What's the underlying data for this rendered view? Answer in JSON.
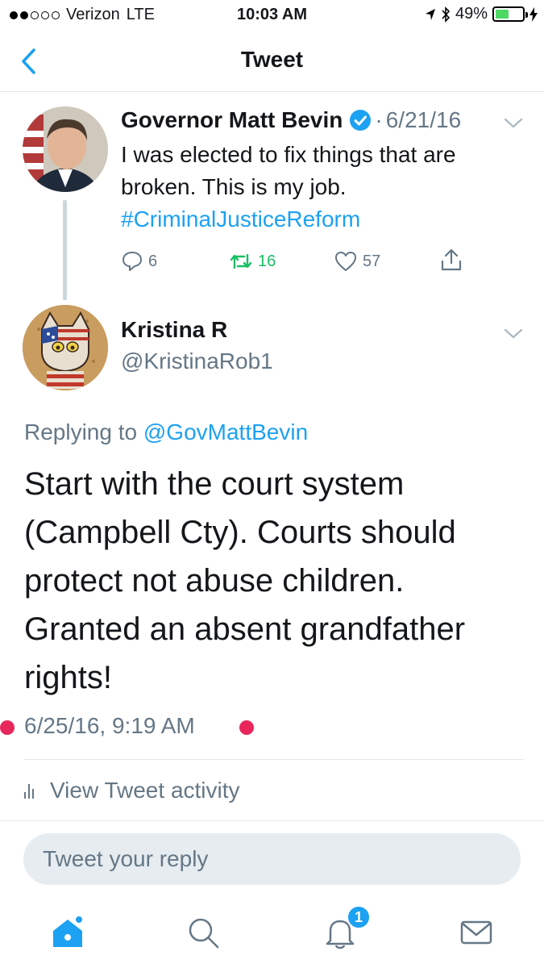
{
  "status_bar": {
    "carrier": "Verizon",
    "network": "LTE",
    "time": "10:03 AM",
    "battery": "49%",
    "battery_level": 0.49,
    "signal_bars": 2
  },
  "nav": {
    "title": "Tweet",
    "back_icon": "chevron-left-icon"
  },
  "parent_tweet": {
    "author": "Governor Matt Bevin",
    "separator": "·",
    "date": "6/21/16",
    "text": "I was elected to fix things that are broken. This is my job.",
    "hashtag": "#CriminalJusticeReform",
    "reply_count": "6",
    "retweet_count": "16",
    "like_count": "57"
  },
  "reply_tweet": {
    "author": "Kristina R",
    "handle": "@KristinaRob1",
    "replying_prefix": "Replying to",
    "replying_to": "@GovMattBevin",
    "text": "Start with the court system (Campbell Cty). Courts should protect not abuse children. Granted an absent grandfather rights!",
    "timestamp": "6/25/16, 9:19 AM"
  },
  "activity": {
    "label": "View Tweet activity"
  },
  "reply_box": {
    "placeholder": "Tweet your reply"
  },
  "tab_bar": {
    "notification_badge": "1"
  },
  "colors": {
    "accent": "#1da1f2",
    "retweet": "#17bf63",
    "muted": "#657786",
    "marker": "#e8265b"
  }
}
